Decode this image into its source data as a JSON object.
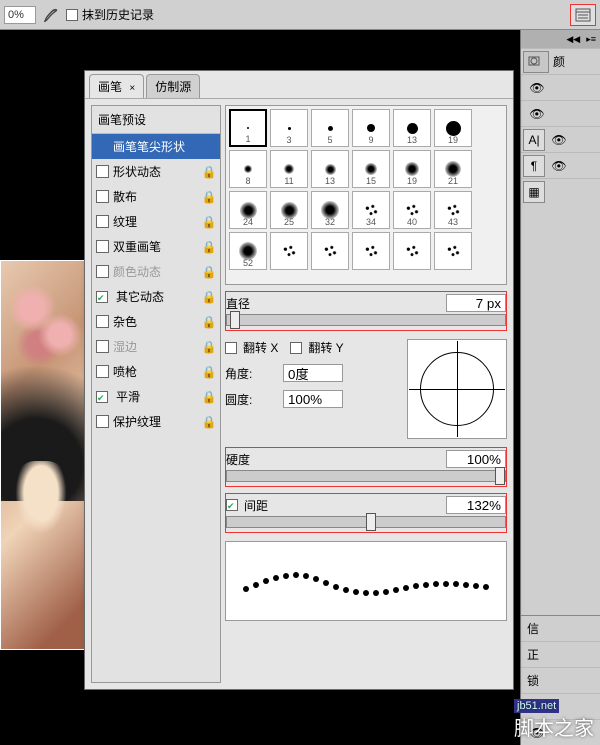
{
  "toolbar": {
    "opacity_value": "0%",
    "history_eraser_label": "抹到历史记录"
  },
  "panel": {
    "tabs": {
      "brush": "画笔",
      "clone": "仿制源"
    },
    "sidebar": {
      "presets": "画笔预设",
      "tip_shape": "画笔笔尖形状",
      "shape_dynamics": "形状动态",
      "scattering": "散布",
      "texture": "纹理",
      "dual_brush": "双重画笔",
      "color_dynamics": "颜色动态",
      "other_dynamics": "其它动态",
      "noise": "杂色",
      "wet_edges": "湿边",
      "airbrush": "喷枪",
      "smoothing": "平滑",
      "protect_texture": "保护纹理"
    },
    "tips": {
      "row1": [
        "1",
        "3",
        "5",
        "9",
        "13",
        "19"
      ],
      "row2": [
        "8",
        "11",
        "13",
        "15",
        "19",
        "21"
      ],
      "row3": [
        "24",
        "25",
        "32",
        "34",
        "40",
        "43"
      ],
      "row4": [
        "52",
        "",
        "",
        "",
        "",
        ""
      ]
    },
    "diameter": {
      "label": "直径",
      "value": "7 px"
    },
    "flip": {
      "x": "翻转 X",
      "y": "翻转 Y"
    },
    "angle": {
      "label": "角度:",
      "value": "0度"
    },
    "roundness": {
      "label": "圆度:",
      "value": "100%"
    },
    "hardness": {
      "label": "硬度",
      "value": "100%"
    },
    "spacing": {
      "label": "间距",
      "value": "132%"
    }
  },
  "right_panels": {
    "color_tab_short": "颜",
    "info_tab_short": "信",
    "normal_short": "正",
    "lock_short": "锁"
  },
  "watermark": {
    "url": "jb51.net",
    "site": "脚本之家"
  }
}
